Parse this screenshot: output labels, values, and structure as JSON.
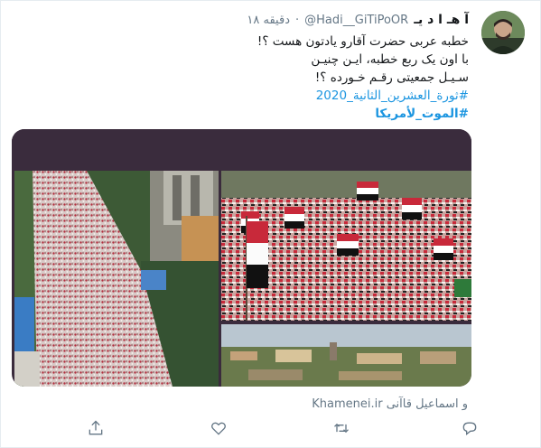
{
  "tweet": {
    "display_name": "آ هـ ا د یـ",
    "handle": "@Hadi__GiTiPoOR",
    "separator": "·",
    "time": "۱۸ دقیقه",
    "lines": [
      "خطبه عربی حضرت آقارو یادتون هست ؟!",
      "با اون یک ربع خطبه، ایـن چنیـن",
      "سـیـل جمعیتی رقـم خـورده ؟!"
    ],
    "hashtag_1": "#ثورة_العشرين_الثانية_2020",
    "hashtag_2": "#الموت_لأمريكا",
    "source": "و اسماعیل قاآنی Khamenei.ir"
  },
  "icons": {
    "avatar": "avatar",
    "reply": "reply-icon",
    "retweet": "retweet-icon",
    "like": "heart-icon",
    "share": "share-icon"
  },
  "colors": {
    "link": "#1b95e0",
    "muted": "#657786",
    "crowd_red": "#c8293a"
  }
}
